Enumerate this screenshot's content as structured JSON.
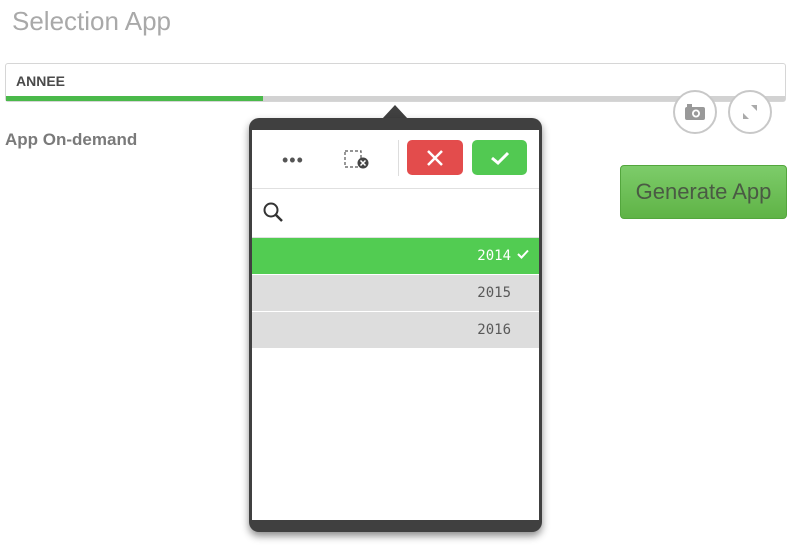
{
  "title": "Selection App",
  "field": {
    "label": "ANNEE",
    "progress": 0.33
  },
  "subtitle": "App On-demand",
  "generate_button": "Generate App",
  "popover": {
    "toolbar": {
      "more": "•••"
    },
    "list": [
      {
        "value": "2014",
        "state": "selected"
      },
      {
        "value": "2015",
        "state": "alternative"
      },
      {
        "value": "2016",
        "state": "alternative"
      }
    ]
  },
  "colors": {
    "selected": "#52cc52",
    "cancel": "#e34c4c",
    "confirm": "#52c952",
    "progress": "#4ab94a"
  }
}
